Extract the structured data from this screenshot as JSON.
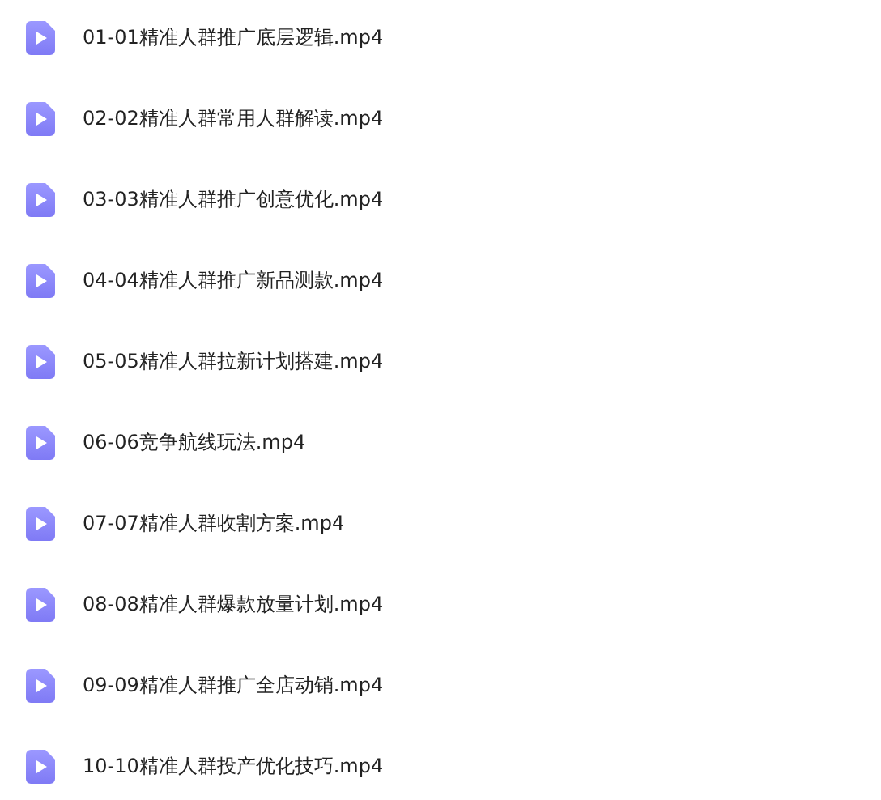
{
  "files": [
    {
      "name": "01-01精准人群推广底层逻辑.mp4"
    },
    {
      "name": "02-02精准人群常用人群解读.mp4"
    },
    {
      "name": "03-03精准人群推广创意优化.mp4"
    },
    {
      "name": "04-04精准人群推广新品测款.mp4"
    },
    {
      "name": "05-05精准人群拉新计划搭建.mp4"
    },
    {
      "name": "06-06竞争航线玩法.mp4"
    },
    {
      "name": "07-07精准人群收割方案.mp4"
    },
    {
      "name": "08-08精准人群爆款放量计划.mp4"
    },
    {
      "name": "09-09精准人群推广全店动销.mp4"
    },
    {
      "name": "10-10精准人群投产优化技巧.mp4"
    }
  ]
}
